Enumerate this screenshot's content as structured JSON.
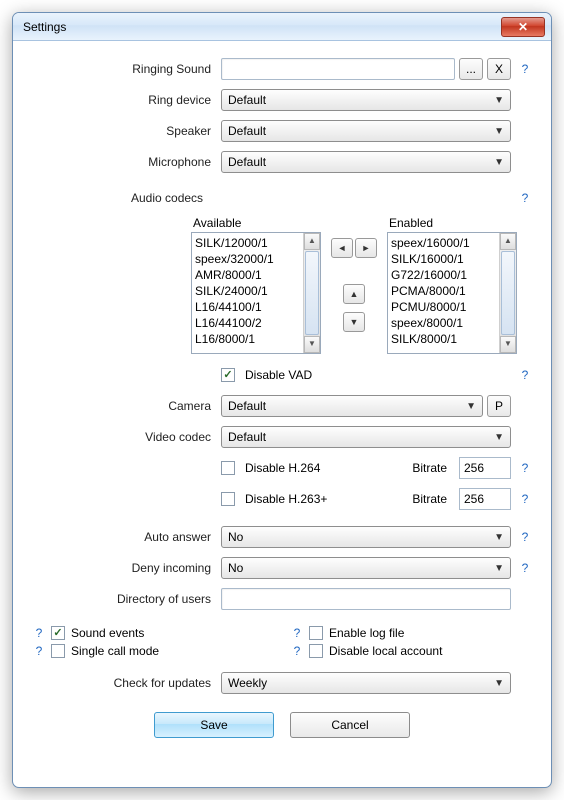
{
  "title": "Settings",
  "help_glyph": "?",
  "labels": {
    "ringing_sound": "Ringing Sound",
    "ring_device": "Ring device",
    "speaker": "Speaker",
    "microphone": "Microphone",
    "audio_codecs": "Audio codecs",
    "available": "Available",
    "enabled": "Enabled",
    "disable_vad": "Disable VAD",
    "camera": "Camera",
    "video_codec": "Video codec",
    "disable_h264": "Disable H.264",
    "disable_h263p": "Disable H.263+",
    "bitrate": "Bitrate",
    "auto_answer": "Auto answer",
    "deny_incoming": "Deny incoming",
    "directory": "Directory of users",
    "sound_events": "Sound events",
    "single_call": "Single call mode",
    "enable_log": "Enable log file",
    "disable_local_acct": "Disable local account",
    "check_updates": "Check for updates"
  },
  "buttons": {
    "browse": "...",
    "clear": "X",
    "camera_p": "P",
    "save": "Save",
    "cancel": "Cancel"
  },
  "values": {
    "ringing_sound": "",
    "ring_device": "Default",
    "speaker": "Default",
    "microphone": "Default",
    "camera": "Default",
    "video_codec": "Default",
    "bitrate_h264": "256",
    "bitrate_h263p": "256",
    "auto_answer": "No",
    "deny_incoming": "No",
    "directory": "",
    "check_updates": "Weekly"
  },
  "checks": {
    "disable_vad": true,
    "disable_h264": false,
    "disable_h263p": false,
    "sound_events": true,
    "single_call": false,
    "enable_log": false,
    "disable_local_acct": false
  },
  "codecs": {
    "available": [
      "SILK/12000/1",
      "speex/32000/1",
      "AMR/8000/1",
      "SILK/24000/1",
      "L16/44100/1",
      "L16/44100/2",
      "L16/8000/1"
    ],
    "enabled": [
      "speex/16000/1",
      "SILK/16000/1",
      "G722/16000/1",
      "PCMA/8000/1",
      "PCMU/8000/1",
      "speex/8000/1",
      "SILK/8000/1"
    ]
  }
}
